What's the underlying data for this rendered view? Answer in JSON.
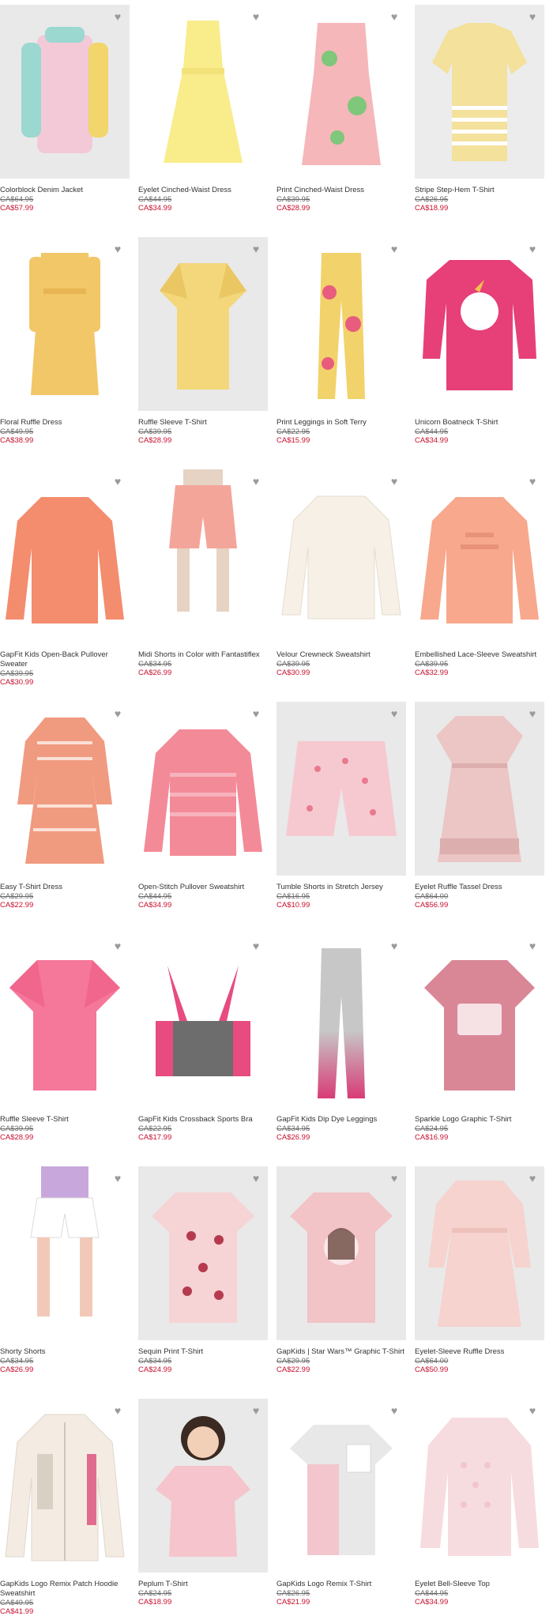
{
  "products": [
    {
      "name": "Colorblock Denim Jacket",
      "was": "CA$64.95",
      "now": "CA$57.99",
      "bg": "#e9e9e9",
      "color": "#f3c9d8",
      "accent": "#9ad8d0"
    },
    {
      "name": "Eyelet Cinched-Waist Dress",
      "was": "CA$44.95",
      "now": "CA$34.99",
      "bg": "#ffffff",
      "color": "#f9ec8a",
      "accent": "#f3e27a"
    },
    {
      "name": "Print Cinched-Waist Dress",
      "was": "CA$39.95",
      "now": "CA$28.99",
      "bg": "#ffffff",
      "color": "#f5b7b9",
      "accent": "#7fc77a"
    },
    {
      "name": "Stripe Step-Hem T-Shirt",
      "was": "CA$26.95",
      "now": "CA$18.99",
      "bg": "#ececec",
      "color": "#f3e19c",
      "accent": "#ffffff"
    },
    {
      "name": "Floral Ruffle Dress",
      "was": "CA$49.95",
      "now": "CA$38.99",
      "bg": "#ffffff",
      "color": "#f2c768",
      "accent": "#e9b554"
    },
    {
      "name": "Ruffle Sleeve T-Shirt",
      "was": "CA$39.95",
      "now": "CA$28.99",
      "bg": "#e9e9e9",
      "color": "#f3d77a",
      "accent": "#eac763"
    },
    {
      "name": "Print Leggings in Soft Terry",
      "was": "CA$22.95",
      "now": "CA$15.99",
      "bg": "#ffffff",
      "color": "#f2d26a",
      "accent": "#e85c7e"
    },
    {
      "name": "Unicorn Boatneck T-Shirt",
      "was": "CA$44.95",
      "now": "CA$34.99",
      "bg": "#ffffff",
      "color": "#e73f77",
      "accent": "#ffffff"
    },
    {
      "name": "GapFit Kids Open-Back Pullover Sweater",
      "was": "CA$39.95",
      "now": "CA$30.99",
      "bg": "#ffffff",
      "color": "#f48c6e",
      "accent": "#f48c6e"
    },
    {
      "name": "Midi Shorts in Color with Fantastiflex",
      "was": "CA$34.95",
      "now": "CA$26.99",
      "bg": "#ffffff",
      "color": "#f4a59a",
      "accent": "#e6d3c3"
    },
    {
      "name": "Velour Crewneck Sweatshirt",
      "was": "CA$39.95",
      "now": "CA$30.99",
      "bg": "#ffffff",
      "color": "#f6f0e6",
      "accent": "#efe6d8"
    },
    {
      "name": "Embellished Lace-Sleeve Sweatshirt",
      "was": "CA$39.95",
      "now": "CA$32.99",
      "bg": "#ffffff",
      "color": "#f7a88d",
      "accent": "#e8927a"
    },
    {
      "name": "Easy T-Shirt Dress",
      "was": "CA$29.95",
      "now": "CA$22.99",
      "bg": "#ffffff",
      "color": "#f09a80",
      "accent": "#fbe0d6"
    },
    {
      "name": "Open-Stitch Pullover Sweatshirt",
      "was": "CA$44.95",
      "now": "CA$34.99",
      "bg": "#ffffff",
      "color": "#f38a98",
      "accent": "#f7b3bd"
    },
    {
      "name": "Tumble Shorts in Stretch Jersey",
      "was": "CA$16.95",
      "now": "CA$10.99",
      "bg": "#e9e9e9",
      "color": "#f6c9d1",
      "accent": "#e97a8e"
    },
    {
      "name": "Eyelet Ruffle Tassel Dress",
      "was": "CA$64.00",
      "now": "CA$56.99",
      "bg": "#e9e9e9",
      "color": "#ebc6c4",
      "accent": "#dcaeae"
    },
    {
      "name": "Ruffle Sleeve T-Shirt",
      "was": "CA$39.95",
      "now": "CA$28.99",
      "bg": "#ffffff",
      "color": "#f5779a",
      "accent": "#f0668c"
    },
    {
      "name": "GapFit Kids Crossback Sports Bra",
      "was": "CA$22.95",
      "now": "CA$17.99",
      "bg": "#ffffff",
      "color": "#6d6d6d",
      "accent": "#e74b80"
    },
    {
      "name": "GapFit Kids Dip Dye Leggings",
      "was": "CA$34.95",
      "now": "CA$26.99",
      "bg": "#ffffff",
      "color": "#c7c7c7",
      "accent": "#d83b76"
    },
    {
      "name": "Sparkle Logo Graphic T-Shirt",
      "was": "CA$24.95",
      "now": "CA$16.99",
      "bg": "#ffffff",
      "color": "#d98796",
      "accent": "#ffffff"
    },
    {
      "name": "Shorty Shorts",
      "was": "CA$34.95",
      "now": "CA$26.99",
      "bg": "#ffffff",
      "color": "#ffffff",
      "accent": "#c8a8dc"
    },
    {
      "name": "Sequin Print T-Shirt",
      "was": "CA$34.95",
      "now": "CA$24.99",
      "bg": "#e9e9e9",
      "color": "#f6d3d5",
      "accent": "#b53a4e"
    },
    {
      "name": "GapKids | Star Wars™ Graphic T-Shirt",
      "was": "CA$29.95",
      "now": "CA$22.99",
      "bg": "#e9e9e9",
      "color": "#f2c3c7",
      "accent": "#6a4a3f"
    },
    {
      "name": "Eyelet-Sleeve Ruffle Dress",
      "was": "CA$64.00",
      "now": "CA$50.99",
      "bg": "#e9e9e9",
      "color": "#f6d3ce",
      "accent": "#eec1bb"
    },
    {
      "name": "GapKids Logo Remix Patch Hoodie Sweatshirt",
      "was": "CA$49.95",
      "now": "CA$41.99",
      "bg": "#ffffff",
      "color": "#f4ece3",
      "accent": "#e06b8f"
    },
    {
      "name": "Peplum T-Shirt",
      "was": "CA$24.95",
      "now": "CA$18.99",
      "bg": "#e9e9e9",
      "color": "#f6c4cc",
      "accent": "#3a2a22"
    },
    {
      "name": "GapKids Logo Remix T-Shirt",
      "was": "CA$26.95",
      "now": "CA$21.99",
      "bg": "#ffffff",
      "color": "#e8e8e8",
      "accent": "#f2c6cc"
    },
    {
      "name": "Eyelet Bell-Sleeve Top",
      "was": "CA$44.95",
      "now": "CA$34.99",
      "bg": "#ffffff",
      "color": "#f7dcdf",
      "accent": "#f1c6cc"
    }
  ]
}
